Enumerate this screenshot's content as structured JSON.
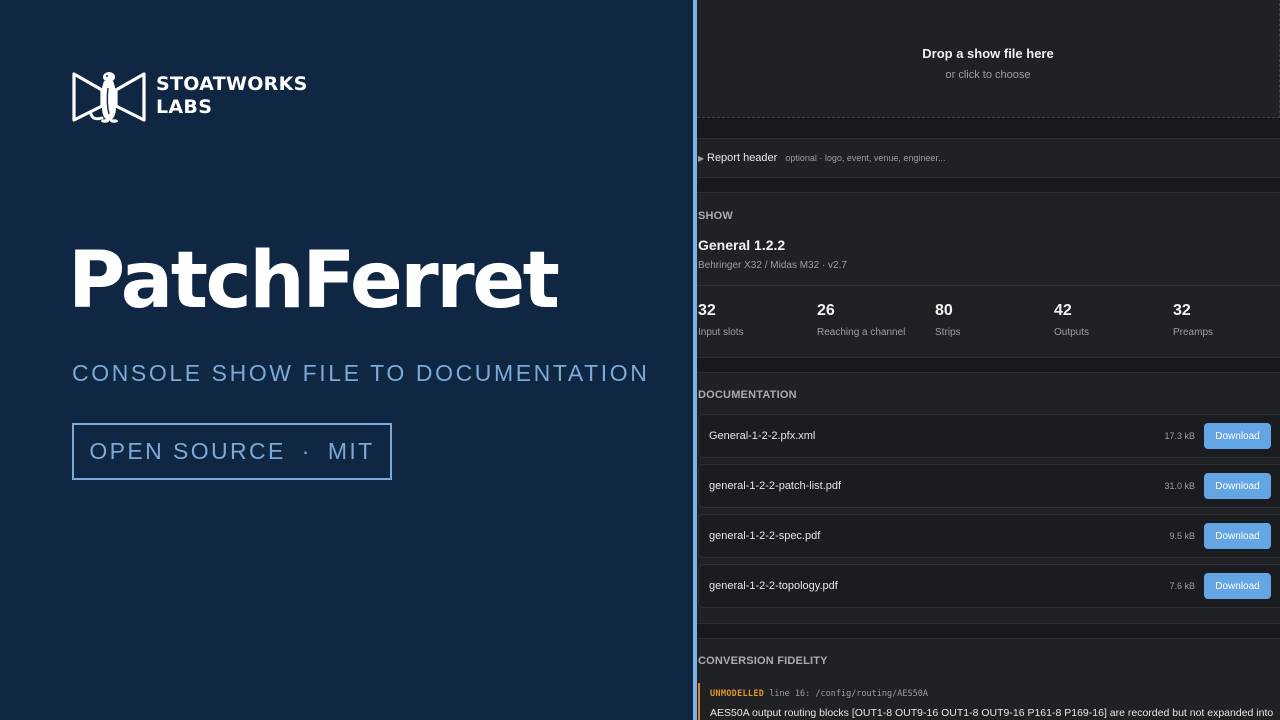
{
  "brand": {
    "line1": "STOATWORKS",
    "line2": "LABS",
    "logo_icon": "stoat-bowtie-logo-icon"
  },
  "hero": {
    "title": "PatchFerret",
    "subtitle": "CONSOLE SHOW FILE TO DOCUMENTATION",
    "badge_left": "OPEN SOURCE",
    "badge_sep": "·",
    "badge_right": "MIT"
  },
  "colors": {
    "hero_bg": "#0f2742",
    "accent": "#7ea8d6",
    "divider": "#7fb0e6",
    "app_bg": "#17191c",
    "card_bg": "#1f2124",
    "button": "#64a6e4",
    "warning": "#e0962f"
  },
  "dropzone": {
    "title": "Drop a show file here",
    "subtitle": "or click to choose"
  },
  "report_header": {
    "caret_icon": "caret-right-icon",
    "title": "Report header",
    "hint": "optional · logo, event, venue, engineer..."
  },
  "show": {
    "section_label": "SHOW",
    "name": "General 1.2.2",
    "console": "Behringer X32 / Midas M32 · v2.7",
    "stats": [
      {
        "value": "32",
        "label": "Input slots"
      },
      {
        "value": "26",
        "label": "Reaching a channel"
      },
      {
        "value": "80",
        "label": "Strips"
      },
      {
        "value": "42",
        "label": "Outputs"
      },
      {
        "value": "32",
        "label": "Preamps"
      }
    ]
  },
  "documentation": {
    "section_label": "DOCUMENTATION",
    "download_label": "Download",
    "files": [
      {
        "name": "General-1-2-2.pfx.xml",
        "size": "17.3 kB"
      },
      {
        "name": "general-1-2-2-patch-list.pdf",
        "size": "31.0 kB"
      },
      {
        "name": "general-1-2-2-spec.pdf",
        "size": "9.5 kB"
      },
      {
        "name": "general-1-2-2-topology.pdf",
        "size": "7.6 kB"
      }
    ]
  },
  "fidelity": {
    "section_label": "CONVERSION FIDELITY",
    "items": [
      {
        "tag": "UNMODELLED",
        "location": "line 16: /config/routing/AES50A",
        "message": "AES50A output routing blocks [OUT1-8 OUT9-16 OUT1-8 OUT9-16 P161-8 P169-16] are recorded but not expanded into"
      }
    ]
  }
}
